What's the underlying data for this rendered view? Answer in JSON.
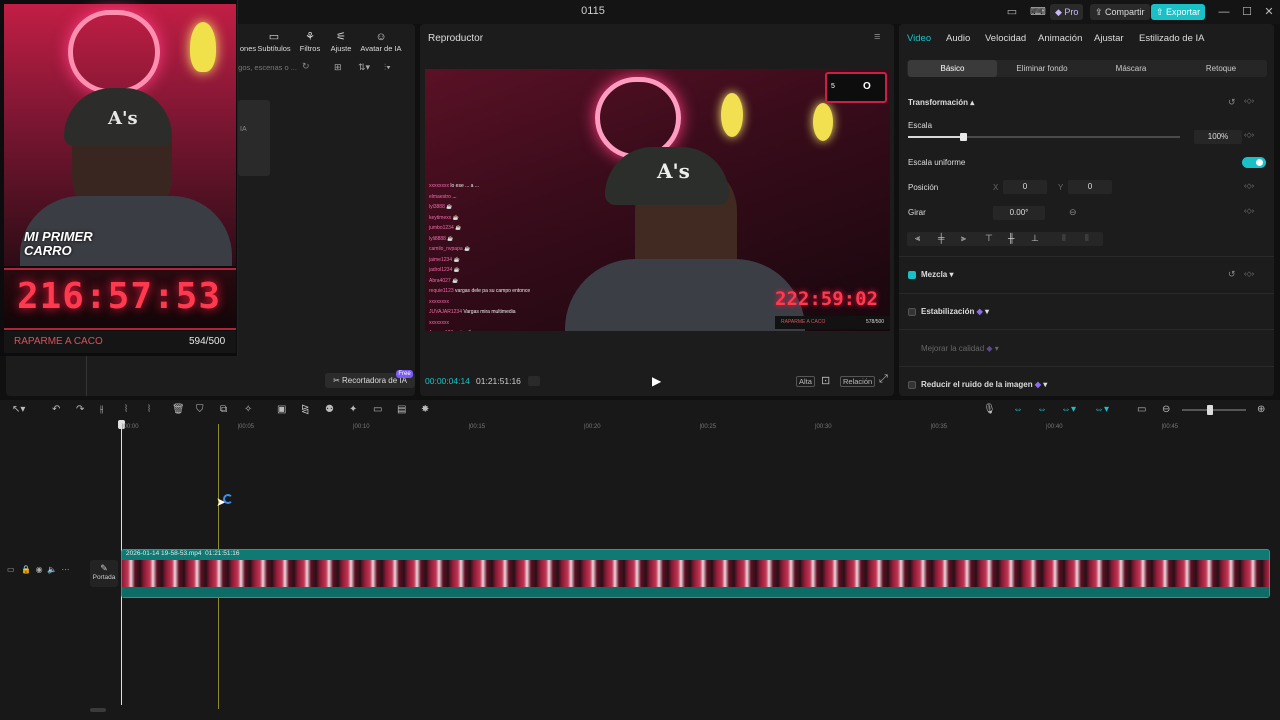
{
  "titlebar": {
    "title": "0115",
    "pro_label": "Pro",
    "share_label": "Compartir",
    "export_label": "Exportar"
  },
  "media": {
    "tabs": [
      "ones",
      "Subtítulos",
      "Filtros",
      "Ajuste",
      "Avatar de IA"
    ],
    "search_placeholder": "ogos, escenas o ...",
    "card_label": "IA",
    "cutter_label": "Recortadora de IA",
    "free_badge": "Free"
  },
  "webcam": {
    "banner": "MI PRIMER CARRO",
    "cap_logo": "A's",
    "timer": "216:57:53",
    "footer_name": "RAPARME A CACO",
    "footer_count": "594/500"
  },
  "player": {
    "title": "Reproductor",
    "score_a": "5",
    "score_b": "O",
    "overlay_timer": "222:59:02",
    "overlay_name": "RAPARME A CACO",
    "overlay_count": "578/500",
    "cap_logo": "A's",
    "chat": [
      {
        "user": "xxxxxxxx",
        "text": "lo ese ... a ..."
      },
      {
        "user": "elmaestro",
        "text": "..."
      },
      {
        "user": "lyl3888",
        "text": "☕"
      },
      {
        "user": "keytimexx",
        "text": "☕"
      },
      {
        "user": "jumbo1234",
        "text": "☕"
      },
      {
        "user": "lyli8888",
        "text": "☕"
      },
      {
        "user": "camilo_nvpapa",
        "text": "☕"
      },
      {
        "user": "jaime1234",
        "text": "☕"
      },
      {
        "user": "jadrol1234",
        "text": "☕"
      },
      {
        "user": "Abra4027",
        "text": "☕"
      },
      {
        "user": "requie1123",
        "text": "vargas dele pa su campo entonce"
      },
      {
        "user": "xxxxxxxx",
        "text": ""
      },
      {
        "user": "JUVAJAR1234",
        "text": "Vargas mira multimedia"
      },
      {
        "user": "xxxxxxxx",
        "text": ""
      },
      {
        "user": "Jocoso123mejia",
        "text": "☕"
      }
    ],
    "current_time": "00:00:04:14",
    "total_time": "01:21:51:16",
    "quality": "Alta",
    "ratio": "Relación"
  },
  "props": {
    "tabs": [
      "Video",
      "Audio",
      "Velocidad",
      "Animación",
      "Ajustar",
      "Estilizado de IA"
    ],
    "subtabs": [
      "Básico",
      "Eliminar fondo",
      "Máscara",
      "Retoque"
    ],
    "transform_label": "Transformación",
    "scale_label": "Escala",
    "scale_value": "100%",
    "uniform_label": "Escala uniforme",
    "position_label": "Posición",
    "pos_x_label": "X",
    "pos_x": "0",
    "pos_y_label": "Y",
    "pos_y": "0",
    "rotate_label": "Girar",
    "rotate_value": "0.00°",
    "blend_label": "Mezcla",
    "stabilize_label": "Estabilización",
    "quality_label": "Mejorar la calidad",
    "denoise_label": "Reducir el ruido de la imagen"
  },
  "timeline": {
    "ruler": [
      "00:00",
      "00:05",
      "00:10",
      "00:15",
      "00:20",
      "00:25",
      "00:30",
      "00:35",
      "00:40",
      "00:45"
    ],
    "clip_name": "2026-01-14 19-58-53.mp4",
    "clip_duration": "01:21:51:16",
    "cover_label": "Portada"
  },
  "colors": {
    "accent": "#19c1c7",
    "panel": "#1c1c1c",
    "clip": "#0f7a73",
    "timer_red": "#ff3a4f"
  }
}
